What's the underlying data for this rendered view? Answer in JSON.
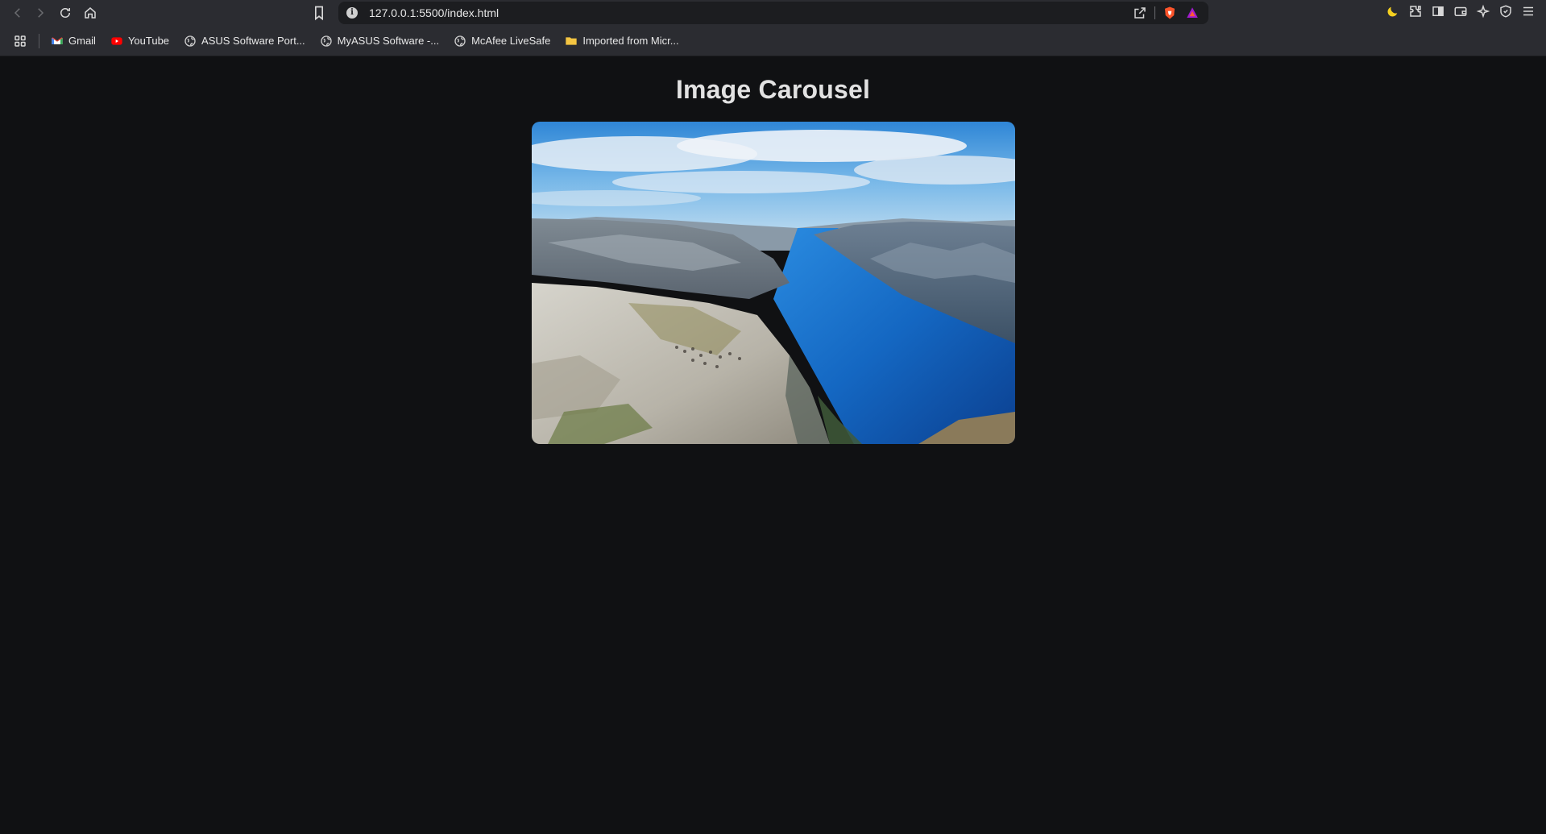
{
  "browser": {
    "url": "127.0.0.1:5500/index.html",
    "bookmarks": [
      {
        "label": "Gmail",
        "icon": "gmail-icon"
      },
      {
        "label": "YouTube",
        "icon": "youtube-icon"
      },
      {
        "label": "ASUS Software Port...",
        "icon": "globe-icon"
      },
      {
        "label": "MyASUS Software -...",
        "icon": "globe-icon"
      },
      {
        "label": "McAfee LiveSafe",
        "icon": "globe-icon"
      },
      {
        "label": "Imported from Micr...",
        "icon": "folder-icon"
      }
    ]
  },
  "page": {
    "title": "Image Carousel",
    "carousel": {
      "current_image": "fjord-cliff-landscape"
    }
  },
  "colors": {
    "page_background": "#101113",
    "chrome_background": "#2b2c31",
    "title_color": "#e2e2e2"
  }
}
